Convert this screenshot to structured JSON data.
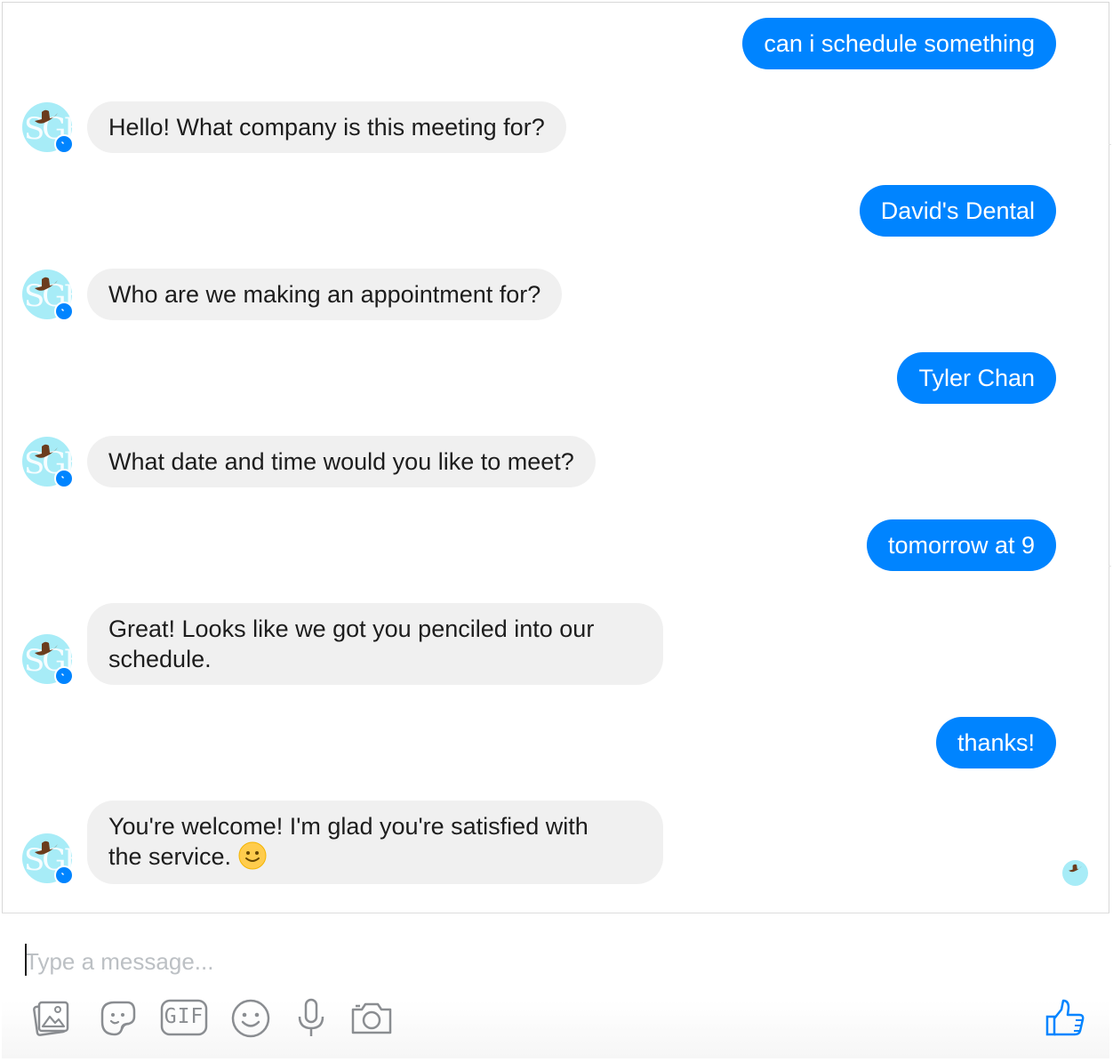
{
  "conversation": {
    "messages": [
      {
        "from": "me",
        "text": "can i schedule something"
      },
      {
        "from": "bot",
        "text": "Hello!  What company is this meeting for?"
      },
      {
        "from": "me",
        "text": "David's Dental"
      },
      {
        "from": "bot",
        "text": "Who are we making an appointment for?"
      },
      {
        "from": "me",
        "text": "Tyler Chan"
      },
      {
        "from": "bot",
        "text": "What date and time would you like to meet?"
      },
      {
        "from": "me",
        "text": "tomorrow at 9"
      },
      {
        "from": "bot",
        "text_line1": "Great! Looks like we got you penciled into our",
        "text_line2": "schedule."
      },
      {
        "from": "me",
        "text": "thanks!"
      },
      {
        "from": "bot",
        "text_line1": "You're welcome!  I'm glad you're satisfied with",
        "text_line2": "the service.",
        "emoji": "slightly-smiling-face"
      }
    ]
  },
  "composer": {
    "placeholder": "Type a message...",
    "tools": [
      "photo-icon",
      "sticker-icon",
      "gif-icon",
      "emoji-icon",
      "microphone-icon",
      "camera-icon"
    ],
    "gif_label": "GIF",
    "send_action": "thumbs-up-icon"
  },
  "colors": {
    "outgoing_bubble": "#0084ff",
    "incoming_bubble": "#f0f0f0",
    "avatar_bg": "#a7ecf7",
    "icon_gray": "#8a8d91",
    "like_blue": "#0084ff"
  }
}
